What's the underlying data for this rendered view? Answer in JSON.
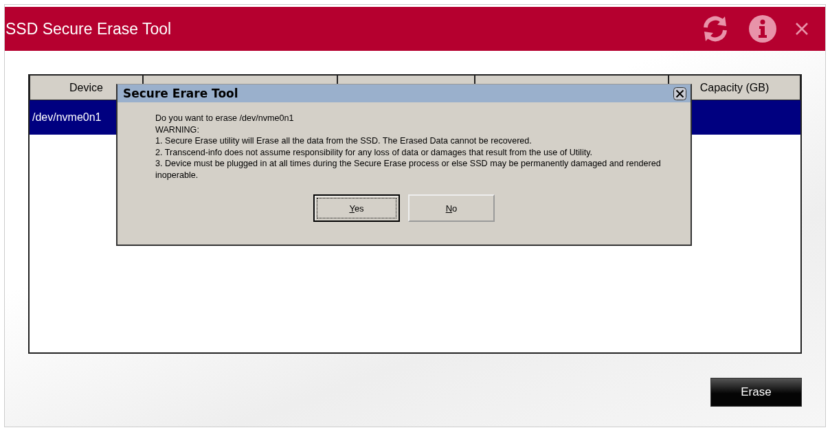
{
  "window": {
    "title": "SSD Secure Erase Tool"
  },
  "table": {
    "columns": [
      "Device",
      "",
      "",
      "",
      "Capacity (GB)"
    ],
    "rows": [
      {
        "device": "/dev/nvme0n1",
        "selected": true
      }
    ]
  },
  "dialog": {
    "title": "Secure Erare Tool",
    "lines": [
      "Do you want to erase /dev/nvme0n1",
      "WARNING:",
      "1. Secure Erase utility will Erase all the data from the SSD. The Erased Data cannot be recovered.",
      "2. Transcend-info does not assume responsibility for any loss of data or damages that result from the use of Utility.",
      "3. Device must be plugged in at all times during the Secure Erase process or else SSD may be permanently damaged and rendered inoperable."
    ],
    "buttons": [
      {
        "label": "Yes",
        "selected": true
      },
      {
        "label": "No",
        "selected": false
      }
    ]
  },
  "buttons": [
    {
      "label": "Erase"
    }
  ]
}
